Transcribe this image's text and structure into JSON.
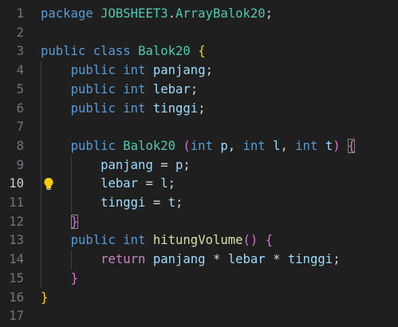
{
  "editor": {
    "language": "java",
    "current_line": "10",
    "lines": [
      {
        "n": "1",
        "text": "package JOBSHEET3.ArrayBalok20;"
      },
      {
        "n": "2",
        "text": ""
      },
      {
        "n": "3",
        "text": "public class Balok20 {"
      },
      {
        "n": "4",
        "text": "    public int panjang;"
      },
      {
        "n": "5",
        "text": "    public int lebar;"
      },
      {
        "n": "6",
        "text": "    public int tinggi;"
      },
      {
        "n": "7",
        "text": ""
      },
      {
        "n": "8",
        "text": "    public Balok20 (int p, int l, int t) {"
      },
      {
        "n": "9",
        "text": "        panjang = p;"
      },
      {
        "n": "10",
        "text": "        lebar = l;"
      },
      {
        "n": "11",
        "text": "        tinggi = t;"
      },
      {
        "n": "12",
        "text": "    }"
      },
      {
        "n": "13",
        "text": "    public int hitungVolume() {"
      },
      {
        "n": "14",
        "text": "        return panjang * lebar * tinggi;"
      },
      {
        "n": "15",
        "text": "    }"
      },
      {
        "n": "16",
        "text": "}"
      },
      {
        "n": "17",
        "text": ""
      }
    ]
  },
  "gutter": {
    "lightbulb_icon": "lightbulb-icon"
  },
  "colors": {
    "background": "#1f1f1f",
    "keyword": "#569cd6",
    "control_keyword": "#c586c0",
    "class_name": "#4ec9b0",
    "function_name": "#dcdcaa",
    "variable": "#9cdcfe",
    "bracket_level_1": "#ffd700",
    "bracket_level_2": "#da70d6",
    "bracket_level_3": "#179fff",
    "line_number": "#6e7681"
  }
}
